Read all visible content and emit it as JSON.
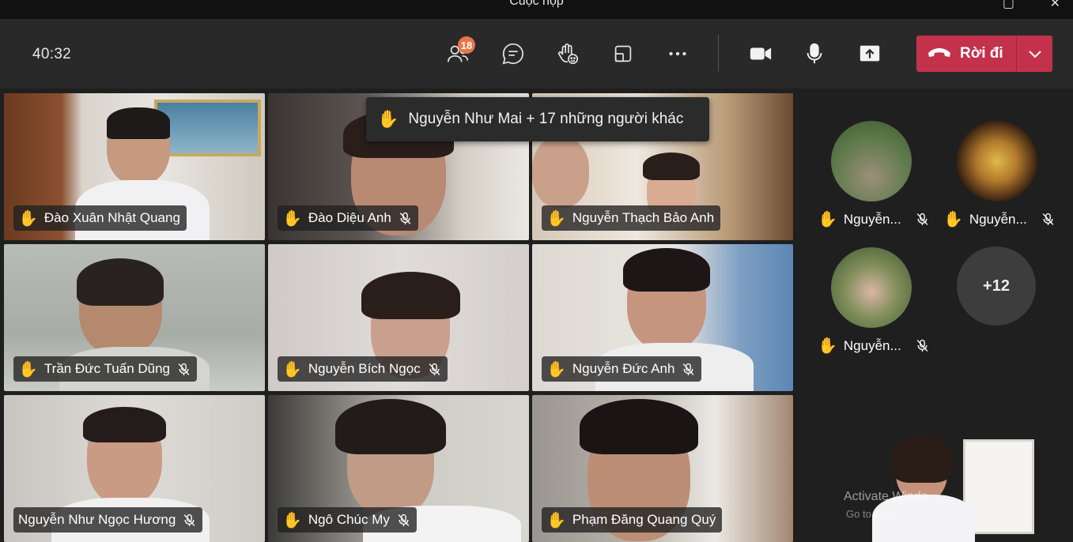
{
  "window": {
    "title": "Cuộc họp"
  },
  "toolbar": {
    "timer": "40:32",
    "participants_count": "18",
    "leave_label": "Rời đi",
    "icons": [
      "people-icon",
      "chat-icon",
      "raise-hand-icon",
      "rooms-icon",
      "more-icon",
      "camera-icon",
      "mic-icon",
      "share-icon",
      "phone-icon",
      "chevron-down-icon"
    ]
  },
  "notification": {
    "text": "Nguyễn Như Mai + 17 những người khác"
  },
  "grid": [
    {
      "name": "Đào Xuân Nhật Quang",
      "muted": false
    },
    {
      "name": "Đào Diệu Anh",
      "muted": true
    },
    {
      "name": "Nguyễn Thạch Bảo Anh",
      "muted": false
    },
    {
      "name": "Trần Đức Tuấn Dũng",
      "muted": true
    },
    {
      "name": "Nguyễn Bích Ngọc",
      "muted": true
    },
    {
      "name": "Nguyễn Đức Anh",
      "muted": true
    },
    {
      "name": "Nguyễn Như Ngọc Hương",
      "muted": true
    },
    {
      "name": "Ngô Chúc My",
      "muted": true
    },
    {
      "name": "Phạm Đăng Quang Quý",
      "muted": false
    }
  ],
  "side": [
    {
      "name": "Nguyễn...",
      "muted": true
    },
    {
      "name": "Nguyễn...",
      "muted": true
    },
    {
      "name": "Nguyễn...",
      "muted": true
    }
  ],
  "more_participants": "+12",
  "self_view": {
    "watermark_1": "Activate Windo",
    "watermark_2": "Go to          s to"
  }
}
